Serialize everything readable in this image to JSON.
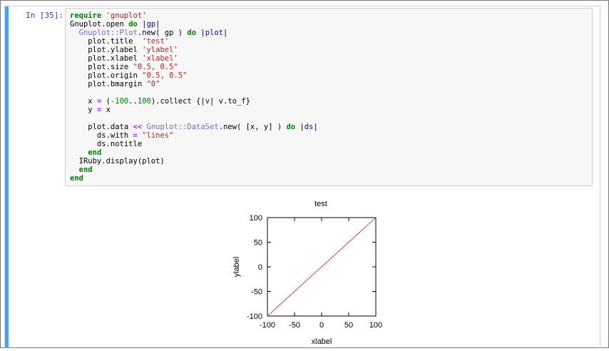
{
  "prompt": "In [35]:",
  "code_lines": [
    [
      {
        "t": "require",
        "c": "kw"
      },
      {
        "t": " "
      },
      {
        "t": "'gnuplot'",
        "c": "str"
      }
    ],
    [
      {
        "t": "Gnuplot",
        "c": ""
      },
      {
        "t": ".open "
      },
      {
        "t": "do",
        "c": "kw"
      },
      {
        "t": " |"
      },
      {
        "t": "gp",
        "c": "var"
      },
      {
        "t": "|"
      }
    ],
    [
      {
        "t": "  "
      },
      {
        "t": "Gnuplot::Plot",
        "c": "cls"
      },
      {
        "t": ".new( gp ) "
      },
      {
        "t": "do",
        "c": "kw"
      },
      {
        "t": " |"
      },
      {
        "t": "plot",
        "c": "var"
      },
      {
        "t": "|"
      }
    ],
    [
      {
        "t": "    plot.title  "
      },
      {
        "t": "'test'",
        "c": "str"
      }
    ],
    [
      {
        "t": "    plot.ylabel "
      },
      {
        "t": "'ylabel'",
        "c": "str"
      }
    ],
    [
      {
        "t": "    plot.xlabel "
      },
      {
        "t": "'xlabel'",
        "c": "str"
      }
    ],
    [
      {
        "t": "    plot.size "
      },
      {
        "t": "\"0.5, 0.5\"",
        "c": "str"
      }
    ],
    [
      {
        "t": "    plot.origin "
      },
      {
        "t": "\"0.5, 0.5\"",
        "c": "str"
      }
    ],
    [
      {
        "t": "    plot.bmargin "
      },
      {
        "t": "\"0\"",
        "c": "str"
      }
    ],
    [
      {
        "t": ""
      }
    ],
    [
      {
        "t": "    x "
      },
      {
        "t": "=",
        "c": "op"
      },
      {
        "t": " ("
      },
      {
        "t": "-100",
        "c": "num"
      },
      {
        "t": ".."
      },
      {
        "t": "100",
        "c": "num"
      },
      {
        "t": ").collect {|"
      },
      {
        "t": "v",
        "c": "var"
      },
      {
        "t": "| v.to_f}"
      }
    ],
    [
      {
        "t": "    y "
      },
      {
        "t": "=",
        "c": "op"
      },
      {
        "t": " x"
      }
    ],
    [
      {
        "t": ""
      }
    ],
    [
      {
        "t": "    plot.data "
      },
      {
        "t": "<<",
        "c": "op"
      },
      {
        "t": " "
      },
      {
        "t": "Gnuplot::DataSet",
        "c": "cls"
      },
      {
        "t": ".new( [x, y] ) "
      },
      {
        "t": "do",
        "c": "kw"
      },
      {
        "t": " |"
      },
      {
        "t": "ds",
        "c": "var"
      },
      {
        "t": "|"
      }
    ],
    [
      {
        "t": "      ds.with "
      },
      {
        "t": "=",
        "c": "op"
      },
      {
        "t": " "
      },
      {
        "t": "\"lines\"",
        "c": "str"
      }
    ],
    [
      {
        "t": "      ds.notitle"
      }
    ],
    [
      {
        "t": "    "
      },
      {
        "t": "end",
        "c": "kw"
      }
    ],
    [
      {
        "t": "  IRuby.display(plot)"
      }
    ],
    [
      {
        "t": "  "
      },
      {
        "t": "end",
        "c": "kw"
      }
    ],
    [
      {
        "t": "end",
        "c": "kw"
      }
    ]
  ],
  "colors": {
    "cell_bar": "#42a5f5",
    "series_line": "#e41a1c"
  },
  "chart_data": {
    "type": "line",
    "title": "test",
    "xlabel": "xlabel",
    "ylabel": "ylabel",
    "xlim": [
      -100,
      100
    ],
    "ylim": [
      -100,
      100
    ],
    "xticks": [
      -100,
      -50,
      0,
      50,
      100
    ],
    "yticks": [
      -100,
      -50,
      0,
      50,
      100
    ],
    "grid": false,
    "series": [
      {
        "x": [
          -100,
          100
        ],
        "y": [
          -100,
          100
        ]
      }
    ]
  }
}
